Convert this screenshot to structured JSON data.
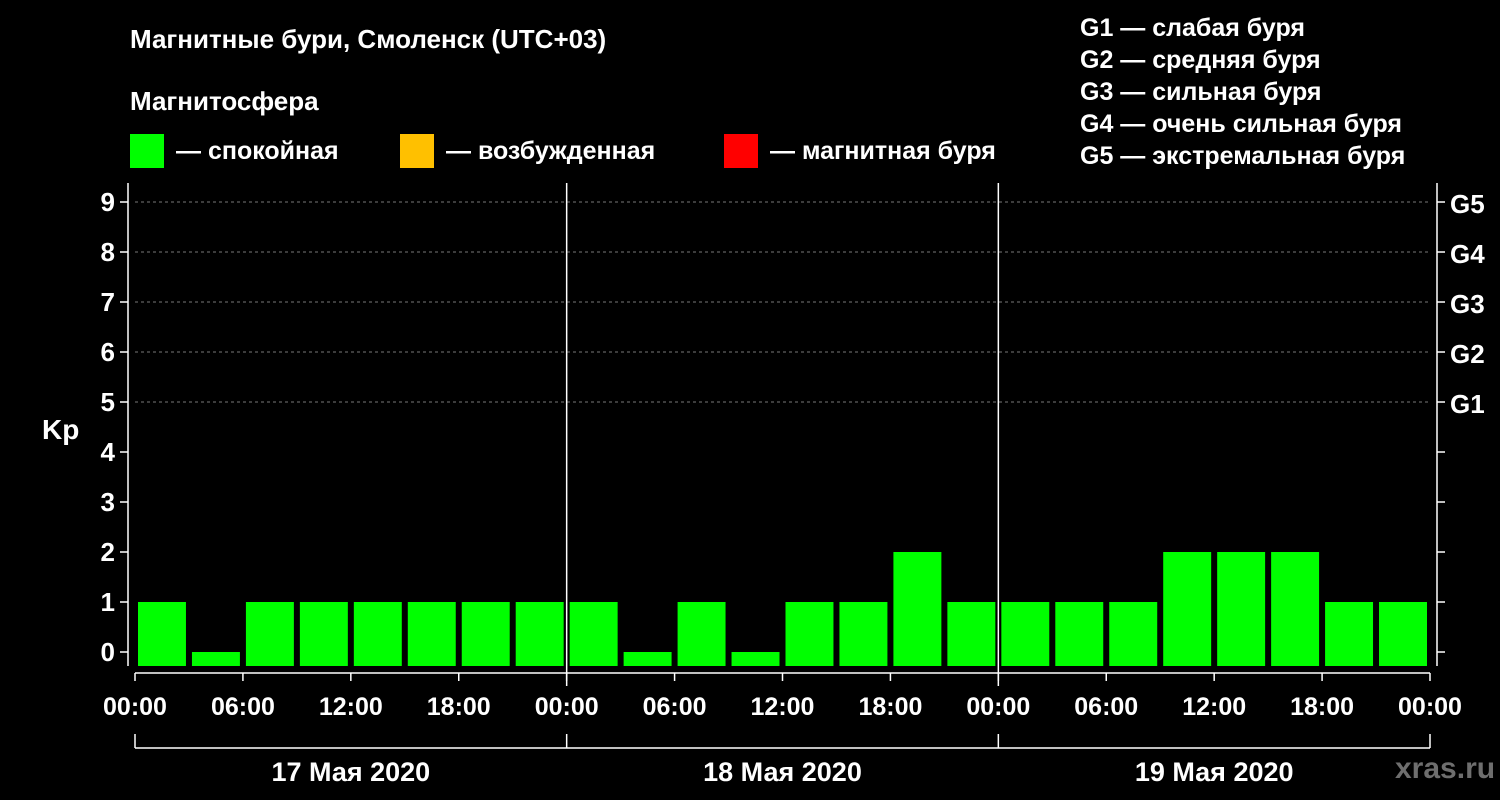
{
  "header": {
    "title": "Магнитные бури, Смоленск (UTC+03)",
    "magnetosphere_label": "Магнитосфера"
  },
  "legend": {
    "quiet": {
      "label": "— спокойная",
      "color": "#00ff00"
    },
    "excited": {
      "label": "— возбужденная",
      "color": "#ffc000"
    },
    "storm": {
      "label": "— магнитная буря",
      "color": "#ff0000"
    }
  },
  "storm_scale": [
    "G1 — слабая буря",
    "G2 — средняя буря",
    "G3 — сильная буря",
    "G4 — очень сильная буря",
    "G5 — экстремальная буря"
  ],
  "watermark": "xras.ru",
  "chart_data": {
    "type": "bar",
    "ylabel": "Kp",
    "ylim": [
      0,
      9
    ],
    "y_ticks": [
      "0",
      "1",
      "2",
      "3",
      "4",
      "5",
      "6",
      "7",
      "8",
      "9"
    ],
    "right_ticks": [
      {
        "kp": 5,
        "label": "G1"
      },
      {
        "kp": 6,
        "label": "G2"
      },
      {
        "kp": 7,
        "label": "G3"
      },
      {
        "kp": 8,
        "label": "G4"
      },
      {
        "kp": 9,
        "label": "G5"
      }
    ],
    "grid": "dashed horizontal lines from Kp 5 to 9",
    "x_tick_labels": [
      "00:00",
      "06:00",
      "12:00",
      "18:00",
      "00:00",
      "06:00",
      "12:00",
      "18:00",
      "00:00",
      "06:00",
      "12:00",
      "18:00",
      "00:00"
    ],
    "days": [
      "17 Мая 2020",
      "18 Мая 2020",
      "19 Мая 2020"
    ],
    "interval_hours": 3,
    "series": [
      {
        "values": [
          1,
          0,
          1,
          1,
          1,
          1,
          1,
          1,
          1,
          0,
          1,
          0,
          1,
          1,
          2,
          1,
          1,
          1,
          1,
          2,
          2,
          2,
          1,
          1
        ]
      }
    ],
    "color_rule": {
      "quiet_max": 4,
      "excited_max": 4.67
    }
  }
}
